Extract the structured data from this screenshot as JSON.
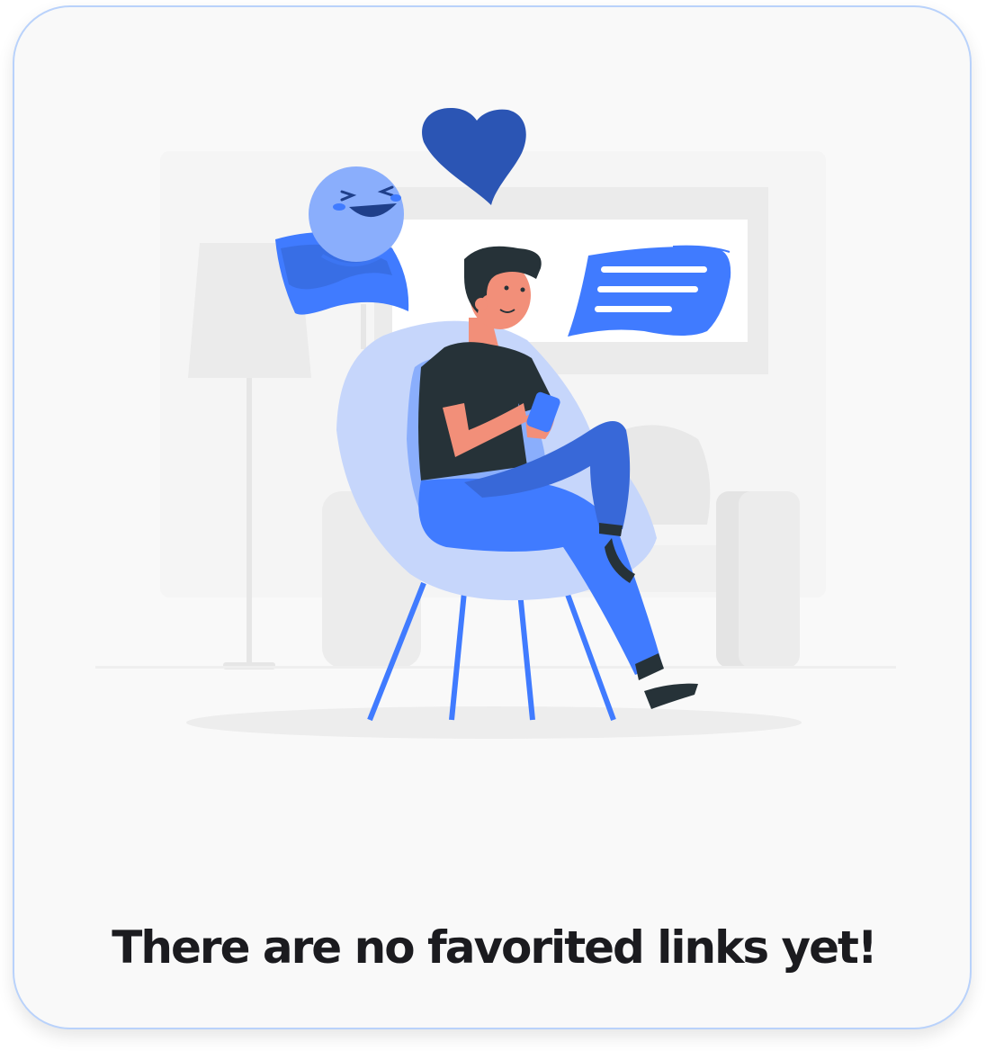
{
  "empty_state": {
    "message": "There are no favorited links yet!",
    "illustration": "person-on-chair-with-phone-illustration",
    "icons": [
      "heart-icon",
      "laughing-emoji-icon",
      "chat-bubble-icon"
    ]
  },
  "colors": {
    "card_border": "#b9d2fb",
    "card_background": "#f9f9f9",
    "accent_blue": "#407bff",
    "dark_blue": "#2b55b4",
    "light_blue": "#c6d6fb",
    "text": "#1b1b1f"
  }
}
